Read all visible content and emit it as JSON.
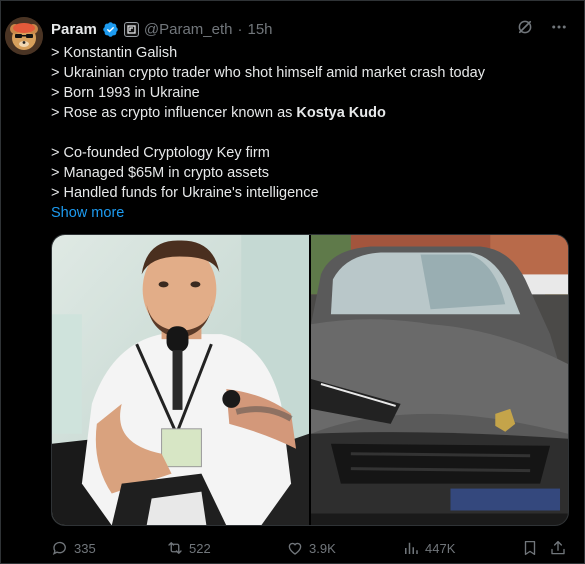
{
  "post": {
    "author_name": "Param",
    "handle": "@Param_eth",
    "separator": "·",
    "time": "15h",
    "lines": [
      "> Konstantin Galish",
      "> Ukrainian crypto trader who shot himself amid market crash today",
      "> Born 1993 in Ukraine"
    ],
    "line4_prefix": "> Rose as crypto influencer known as ",
    "line4_bold": "Kostya Kudo",
    "lines2": [
      "> Co-founded Cryptology Key firm",
      "> Managed $65M in crypto assets",
      "> Handled funds for Ukraine's intelligence"
    ],
    "show_more": "Show more"
  },
  "metrics": {
    "replies": "335",
    "reposts": "522",
    "likes": "3.9K",
    "views": "447K"
  },
  "colors": {
    "background": "#000000",
    "text": "#e7e9ea",
    "muted": "#71767b",
    "link": "#1d9bf0",
    "verified": "#1d9bf0"
  },
  "icons": {
    "verified": "verified-badge-icon",
    "affiliation": "affiliate-logo-icon",
    "grok": "grok-icon",
    "more": "more-icon",
    "reply": "reply-icon",
    "repost": "repost-icon",
    "like": "like-icon",
    "views": "views-icon",
    "bookmark": "bookmark-icon",
    "share": "share-icon"
  }
}
